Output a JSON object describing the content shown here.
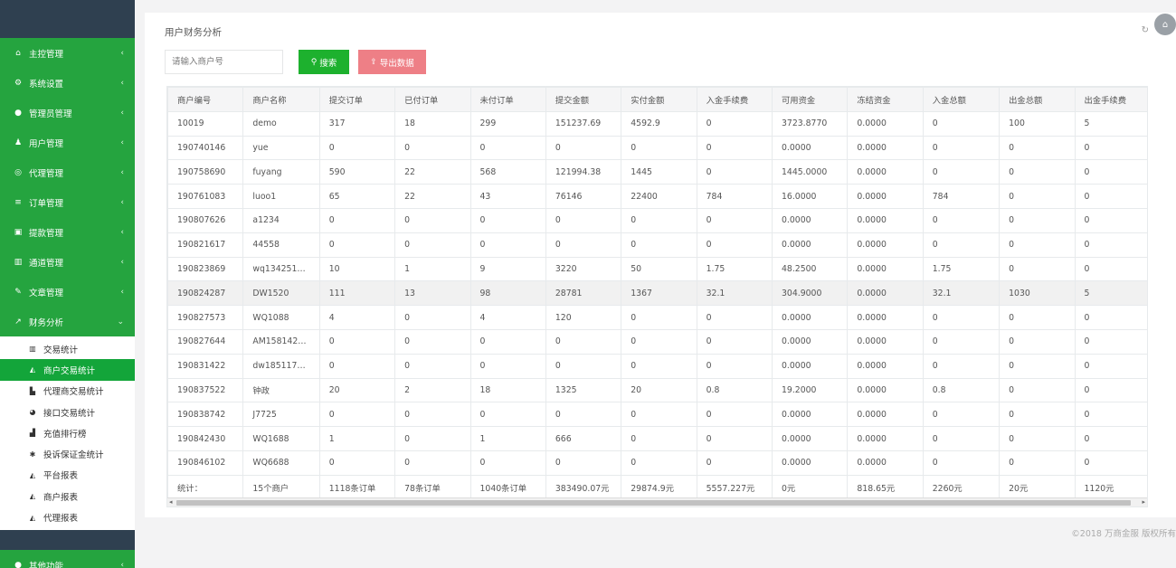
{
  "sidebar": {
    "items": [
      {
        "label": "主控管理",
        "icon": "home-icon",
        "glyph": "⌂"
      },
      {
        "label": "系统设置",
        "icon": "cogs-icon",
        "glyph": "⚙"
      },
      {
        "label": "管理员管理",
        "icon": "user-circle-icon",
        "glyph": "●"
      },
      {
        "label": "用户管理",
        "icon": "users-icon",
        "glyph": "♟"
      },
      {
        "label": "代理管理",
        "icon": "handshake-icon",
        "glyph": "◎"
      },
      {
        "label": "订单管理",
        "icon": "list-icon",
        "glyph": "≡"
      },
      {
        "label": "提款管理",
        "icon": "lock-icon",
        "glyph": "▣"
      },
      {
        "label": "通道管理",
        "icon": "bank-icon",
        "glyph": "▥"
      },
      {
        "label": "文章管理",
        "icon": "edit-icon",
        "glyph": "✎"
      }
    ],
    "expanded": {
      "label": "财务分析",
      "icon": "line-chart-icon",
      "glyph": "↗"
    },
    "subitems": [
      {
        "label": "交易统计",
        "icon": "bar-chart-icon",
        "glyph": "▥"
      },
      {
        "label": "商户交易统计",
        "icon": "area-chart-icon",
        "glyph": "◭"
      },
      {
        "label": "代理商交易统计",
        "icon": "bar-chart-icon",
        "glyph": "▙"
      },
      {
        "label": "接口交易统计",
        "icon": "pie-chart-icon",
        "glyph": "◕"
      },
      {
        "label": "充值排行榜",
        "icon": "signal-icon",
        "glyph": "▟"
      },
      {
        "label": "投诉保证金统计",
        "icon": "asterisk-icon",
        "glyph": "✱"
      },
      {
        "label": "平台报表",
        "icon": "area-chart-icon",
        "glyph": "◭"
      },
      {
        "label": "商户报表",
        "icon": "area-chart-icon",
        "glyph": "◭"
      },
      {
        "label": "代理报表",
        "icon": "area-chart-icon",
        "glyph": "◭"
      }
    ],
    "bottom": {
      "label": "其他功能",
      "icon": "user-circle-icon",
      "glyph": "●"
    },
    "arrow": "‹",
    "arrow_down": "⌄"
  },
  "panel": {
    "title": "用户财务分析",
    "refresh_glyph": "↻",
    "corner_glyph": "⌂"
  },
  "search": {
    "placeholder": "请输入商户号",
    "button_label": "搜索",
    "button_glyph": "⚲",
    "export_label": "导出数据",
    "export_glyph": "⇪"
  },
  "table": {
    "headers": [
      "商户编号",
      "商户名称",
      "提交订单",
      "已付订单",
      "未付订单",
      "提交金额",
      "实付金额",
      "入金手续费",
      "可用资金",
      "冻结资金",
      "入金总额",
      "出金总额",
      "出金手续费"
    ],
    "rows": [
      [
        "10019",
        "demo",
        "317",
        "18",
        "299",
        "151237.69",
        "4592.9",
        "0",
        "3723.8770",
        "0.0000",
        "0",
        "100",
        "5"
      ],
      [
        "190740146",
        "yue",
        "0",
        "0",
        "0",
        "0",
        "0",
        "0",
        "0.0000",
        "0.0000",
        "0",
        "0",
        "0"
      ],
      [
        "190758690",
        "fuyang",
        "590",
        "22",
        "568",
        "121994.38",
        "1445",
        "0",
        "1445.0000",
        "0.0000",
        "0",
        "0",
        "0"
      ],
      [
        "190761083",
        "luoo1",
        "65",
        "22",
        "43",
        "76146",
        "22400",
        "784",
        "16.0000",
        "0.0000",
        "784",
        "0",
        "0"
      ],
      [
        "190807626",
        "a1234",
        "0",
        "0",
        "0",
        "0",
        "0",
        "0",
        "0.0000",
        "0.0000",
        "0",
        "0",
        "0"
      ],
      [
        "190821617",
        "44558",
        "0",
        "0",
        "0",
        "0",
        "0",
        "0",
        "0.0000",
        "0.0000",
        "0",
        "0",
        "0"
      ],
      [
        "190823869",
        "wq1342512...",
        "10",
        "1",
        "9",
        "3220",
        "50",
        "1.75",
        "48.2500",
        "0.0000",
        "1.75",
        "0",
        "0"
      ],
      [
        "190824287",
        "DW1520",
        "111",
        "13",
        "98",
        "28781",
        "1367",
        "32.1",
        "304.9000",
        "0.0000",
        "32.1",
        "1030",
        "5"
      ],
      [
        "190827573",
        "WQ1088",
        "4",
        "0",
        "4",
        "120",
        "0",
        "0",
        "0.0000",
        "0.0000",
        "0",
        "0",
        "0"
      ],
      [
        "190827644",
        "AM1581428...",
        "0",
        "0",
        "0",
        "0",
        "0",
        "0",
        "0.0000",
        "0.0000",
        "0",
        "0",
        "0"
      ],
      [
        "190831422",
        "dw1851171...",
        "0",
        "0",
        "0",
        "0",
        "0",
        "0",
        "0.0000",
        "0.0000",
        "0",
        "0",
        "0"
      ],
      [
        "190837522",
        "钟政",
        "20",
        "2",
        "18",
        "1325",
        "20",
        "0.8",
        "19.2000",
        "0.0000",
        "0.8",
        "0",
        "0"
      ],
      [
        "190838742",
        "J7725",
        "0",
        "0",
        "0",
        "0",
        "0",
        "0",
        "0.0000",
        "0.0000",
        "0",
        "0",
        "0"
      ],
      [
        "190842430",
        "WQ1688",
        "1",
        "0",
        "1",
        "666",
        "0",
        "0",
        "0.0000",
        "0.0000",
        "0",
        "0",
        "0"
      ],
      [
        "190846102",
        "WQ6688",
        "0",
        "0",
        "0",
        "0",
        "0",
        "0",
        "0.0000",
        "0.0000",
        "0",
        "0",
        "0"
      ]
    ],
    "highlighted_row": 7,
    "totals": [
      "统计：",
      "15个商户",
      "1118条订单",
      "78条订单",
      "1040条订单",
      "383490.07元",
      "29874.9元",
      "5557.227元",
      "0元",
      "818.65元",
      "2260元",
      "20元",
      "1120元"
    ],
    "scroll_left": "◂",
    "scroll_right": "▸"
  },
  "footer": {
    "text": "©2018 万商金服 版权所有"
  }
}
